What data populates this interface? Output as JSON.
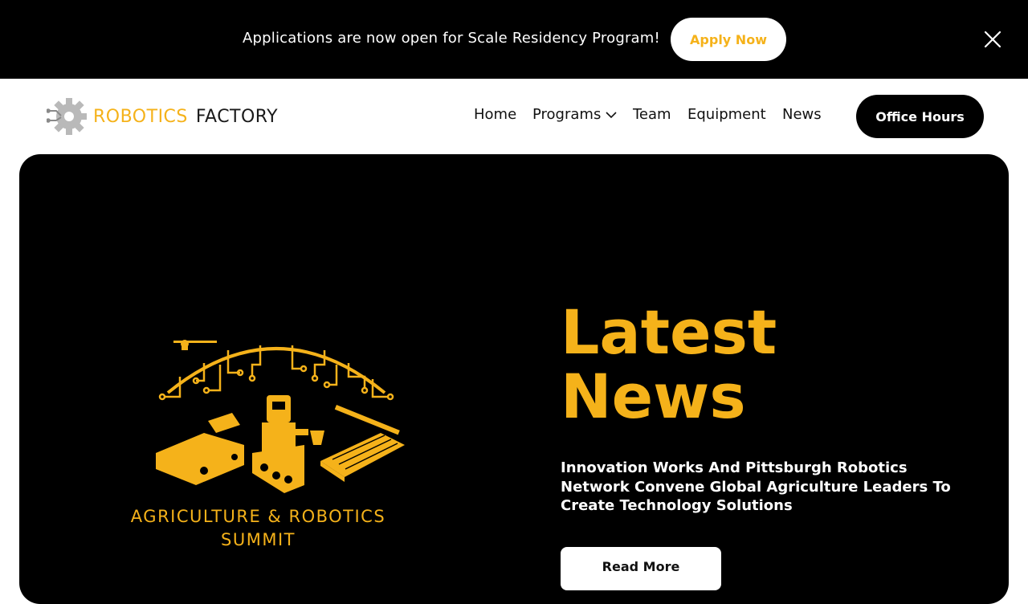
{
  "announcement": {
    "text": "Applications are now open for Scale Residency Program!",
    "apply_label": "Apply Now"
  },
  "header": {
    "logo": {
      "word1": "ROBOTICS",
      "word2": "FACTORY"
    },
    "nav": [
      {
        "label": "Home"
      },
      {
        "label": "Programs"
      },
      {
        "label": "Team"
      },
      {
        "label": "Equipment"
      },
      {
        "label": "News"
      }
    ],
    "cta_label": "Office Hours"
  },
  "hero": {
    "summit_title": "AGRICULTURE & ROBOTICS\nSUMMIT",
    "heading": "Latest\nNews",
    "headline": "Innovation Works And Pittsburgh Robotics Network Convene Global Agriculture Leaders To Create Technology Solutions",
    "read_more_label": "Read More"
  },
  "colors": {
    "accent": "#f5b21a",
    "dark": "#000000",
    "light": "#ffffff"
  }
}
